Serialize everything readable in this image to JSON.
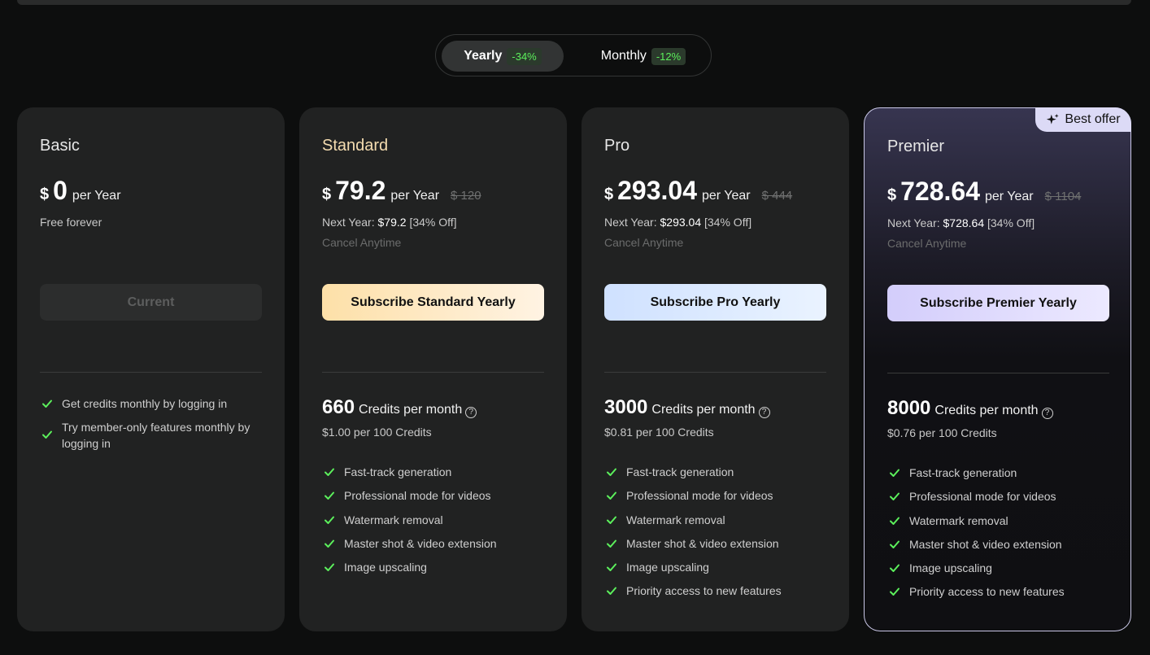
{
  "billing_toggle": {
    "yearly": {
      "label": "Yearly",
      "discount": "-34%"
    },
    "monthly": {
      "label": "Monthly",
      "discount": "-12%"
    }
  },
  "colors": {
    "check": "#5cf05c",
    "background": "#0d0e0e",
    "card": "#212222"
  },
  "plans": [
    {
      "name": "Basic",
      "currency": "$",
      "price": "0",
      "period": "per Year",
      "note": "Free forever",
      "button": "Current",
      "features": [
        "Get credits monthly by logging in",
        "Try member-only features monthly by logging in"
      ]
    },
    {
      "name": "Standard",
      "currency": "$",
      "price": "79.2",
      "period": "per Year",
      "original_price": "$ 120",
      "next_year_label": "Next Year:",
      "next_year_price": "$79.2",
      "next_year_discount": "[34% Off]",
      "cancel": "Cancel Anytime",
      "button": "Subscribe Standard Yearly",
      "credits": "660",
      "credits_label": "Credits per month",
      "credit_price": "$1.00 per 100 Credits",
      "features": [
        "Fast-track generation",
        "Professional mode for videos",
        "Watermark removal",
        "Master shot & video extension",
        "Image upscaling"
      ]
    },
    {
      "name": "Pro",
      "currency": "$",
      "price": "293.04",
      "period": "per Year",
      "original_price": "$ 444",
      "next_year_label": "Next Year:",
      "next_year_price": "$293.04",
      "next_year_discount": "[34% Off]",
      "cancel": "Cancel Anytime",
      "button": "Subscribe Pro Yearly",
      "credits": "3000",
      "credits_label": "Credits per month",
      "credit_price": "$0.81 per 100 Credits",
      "features": [
        "Fast-track generation",
        "Professional mode for videos",
        "Watermark removal",
        "Master shot & video extension",
        "Image upscaling",
        "Priority access to new features"
      ]
    },
    {
      "name": "Premier",
      "badge": "Best offer",
      "currency": "$",
      "price": "728.64",
      "period": "per Year",
      "original_price": "$ 1104",
      "next_year_label": "Next Year:",
      "next_year_price": "$728.64",
      "next_year_discount": "[34% Off]",
      "cancel": "Cancel Anytime",
      "button": "Subscribe Premier Yearly",
      "credits": "8000",
      "credits_label": "Credits per month",
      "credit_price": "$0.76 per 100 Credits",
      "features": [
        "Fast-track generation",
        "Professional mode for videos",
        "Watermark removal",
        "Master shot & video extension",
        "Image upscaling",
        "Priority access to new features"
      ]
    }
  ]
}
